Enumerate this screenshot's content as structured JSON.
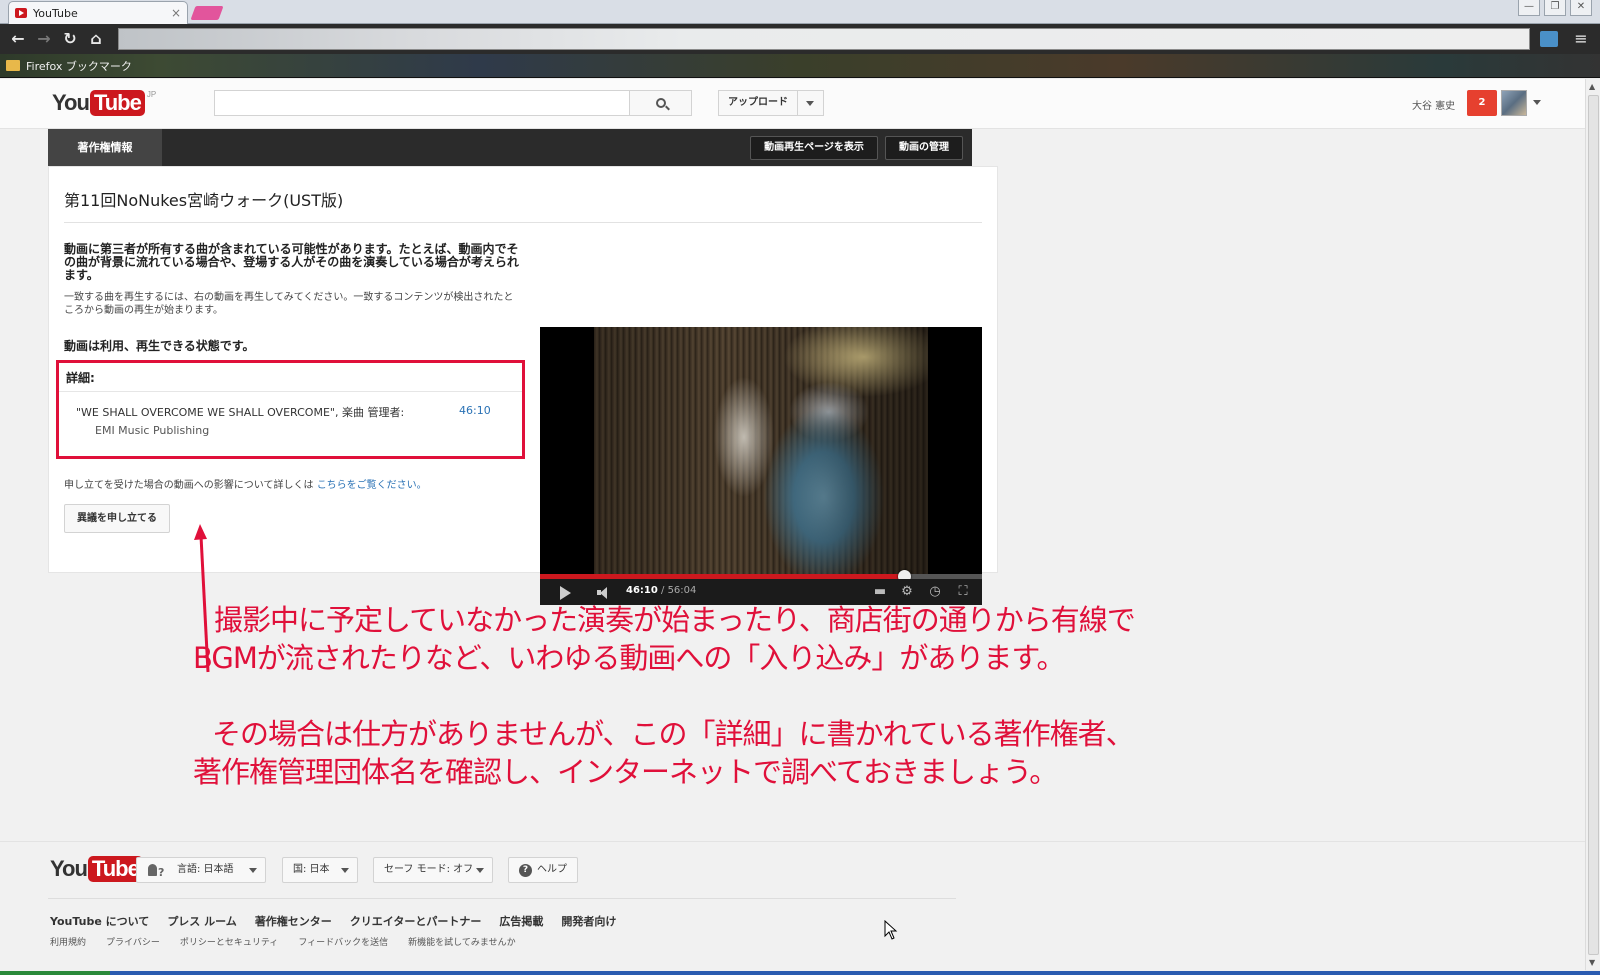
{
  "browser": {
    "tab_title": "YouTube",
    "tab_close": "×",
    "bookmark_folder": "Firefox ブックマーク",
    "back_glyph": "←",
    "forward_glyph": "→",
    "reload_glyph": "↻",
    "home_glyph": "⌂",
    "menu_glyph": "≡",
    "window_buttons": [
      "—",
      "❐",
      "✕"
    ]
  },
  "header": {
    "logo_you": "You",
    "logo_tube": "Tube",
    "logo_region": "JP",
    "upload_label": "アップロード",
    "user_name": "大谷 憲史",
    "notification_count": "2"
  },
  "copyright_bar": {
    "tab_label": "著作権情報",
    "view_page_button": "動画再生ページを表示",
    "manage_button": "動画の管理"
  },
  "card": {
    "video_title": "第11回NoNukes宮崎ウォーク(UST版)",
    "message_bold": "動画に第三者が所有する曲が含まれている可能性があります。たとえば、動画内でその曲が背景に流れている場合や、登場する人がその曲を演奏している場合が考えられます。",
    "message_small": "一致する曲を再生するには、右の動画を再生してみてください。一致するコンテンツが検出されたところから動画の再生が始まります。",
    "status": "動画は利用、再生できる状態です。",
    "details_label": "詳細:",
    "track_text": "\"WE SHALL OVERCOME WE SHALL OVERCOME\", 楽曲 管理者:",
    "track_time": "46:10",
    "publisher": "EMI Music Publishing",
    "effect_text": "申し立てを受けた場合の動画への影響について詳しくは",
    "effect_link": "こちらをご覧ください。",
    "dispute_button": "異議を申し立てる"
  },
  "player": {
    "current_time": "46:10",
    "duration": " / 56:04",
    "progress_fraction": 0.823,
    "captions_icon": "▬",
    "settings_icon": "⚙",
    "watch_later_icon": "◷",
    "fullscreen_icon": "⛶"
  },
  "annotation": {
    "line1": "撮影中に予定していなかった演奏が始まったり、商店街の通りから有線で",
    "line2": "BGMが流されたりなど、いわゆる動画への「入り込み」があります。",
    "line3": "その場合は仕方がありませんが、この「詳細」に書かれている著作権者、",
    "line4": "著作権管理団体名を確認し、インターネットで調べておきましょう。",
    "color": "#e0103a"
  },
  "footer": {
    "language_button": "言語: 日本語",
    "country_button": "国: 日本",
    "safety_button": "セーフ モード: オフ",
    "help_button": "ヘルプ",
    "links": [
      "YouTube について",
      "プレス ルーム",
      "著作権センター",
      "クリエイターとパートナー",
      "広告掲載",
      "開発者向け"
    ],
    "sub_links": [
      "利用規約",
      "プライバシー",
      "ポリシーとセキュリティ",
      "フィードバックを送信",
      "新機能を試してみませんか"
    ]
  }
}
